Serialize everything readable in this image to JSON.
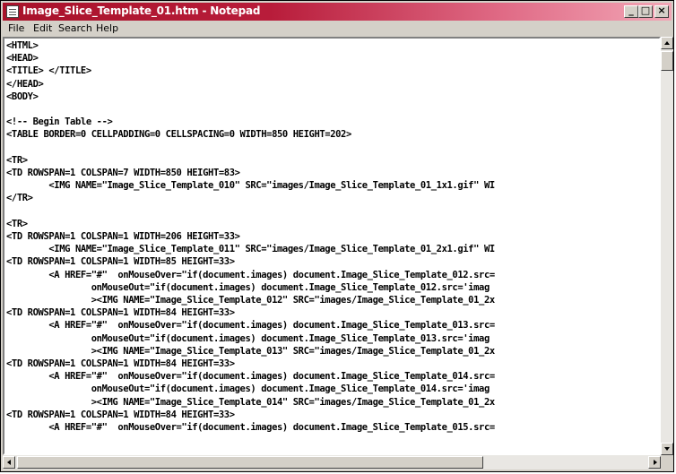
{
  "window": {
    "title": "Image_Slice_Template_01.htm - Notepad",
    "controls": [
      "minimize",
      "maximize",
      "close"
    ]
  },
  "menu": [
    "File",
    "Edit",
    "Search",
    "Help"
  ],
  "document_lines": [
    "<HTML>",
    "<HEAD>",
    "<TITLE> </TITLE>",
    "</HEAD>",
    "<BODY>",
    "",
    "<!-- Begin Table -->",
    "<TABLE BORDER=0 CELLPADDING=0 CELLSPACING=0 WIDTH=850 HEIGHT=202>",
    "",
    "<TR>",
    "<TD ROWSPAN=1 COLSPAN=7 WIDTH=850 HEIGHT=83>",
    "        <IMG NAME=\"Image_Slice_Template_010\" SRC=\"images/Image_Slice_Template_01_1x1.gif\" WI",
    "</TR>",
    "",
    "<TR>",
    "<TD ROWSPAN=1 COLSPAN=1 WIDTH=206 HEIGHT=33>",
    "        <IMG NAME=\"Image_Slice_Template_011\" SRC=\"images/Image_Slice_Template_01_2x1.gif\" WI",
    "<TD ROWSPAN=1 COLSPAN=1 WIDTH=85 HEIGHT=33>",
    "        <A HREF=\"#\"  onMouseOver=\"if(document.images) document.Image_Slice_Template_012.src=",
    "                onMouseOut=\"if(document.images) document.Image_Slice_Template_012.src='imag",
    "                ><IMG NAME=\"Image_Slice_Template_012\" SRC=\"images/Image_Slice_Template_01_2x",
    "<TD ROWSPAN=1 COLSPAN=1 WIDTH=84 HEIGHT=33>",
    "        <A HREF=\"#\"  onMouseOver=\"if(document.images) document.Image_Slice_Template_013.src=",
    "                onMouseOut=\"if(document.images) document.Image_Slice_Template_013.src='imag",
    "                ><IMG NAME=\"Image_Slice_Template_013\" SRC=\"images/Image_Slice_Template_01_2x",
    "<TD ROWSPAN=1 COLSPAN=1 WIDTH=84 HEIGHT=33>",
    "        <A HREF=\"#\"  onMouseOver=\"if(document.images) document.Image_Slice_Template_014.src=",
    "                onMouseOut=\"if(document.images) document.Image_Slice_Template_014.src='imag",
    "                ><IMG NAME=\"Image_Slice_Template_014\" SRC=\"images/Image_Slice_Template_01_2x",
    "<TD ROWSPAN=1 COLSPAN=1 WIDTH=84 HEIGHT=33>",
    "        <A HREF=\"#\"  onMouseOver=\"if(document.images) document.Image_Slice_Template_015.src="
  ]
}
